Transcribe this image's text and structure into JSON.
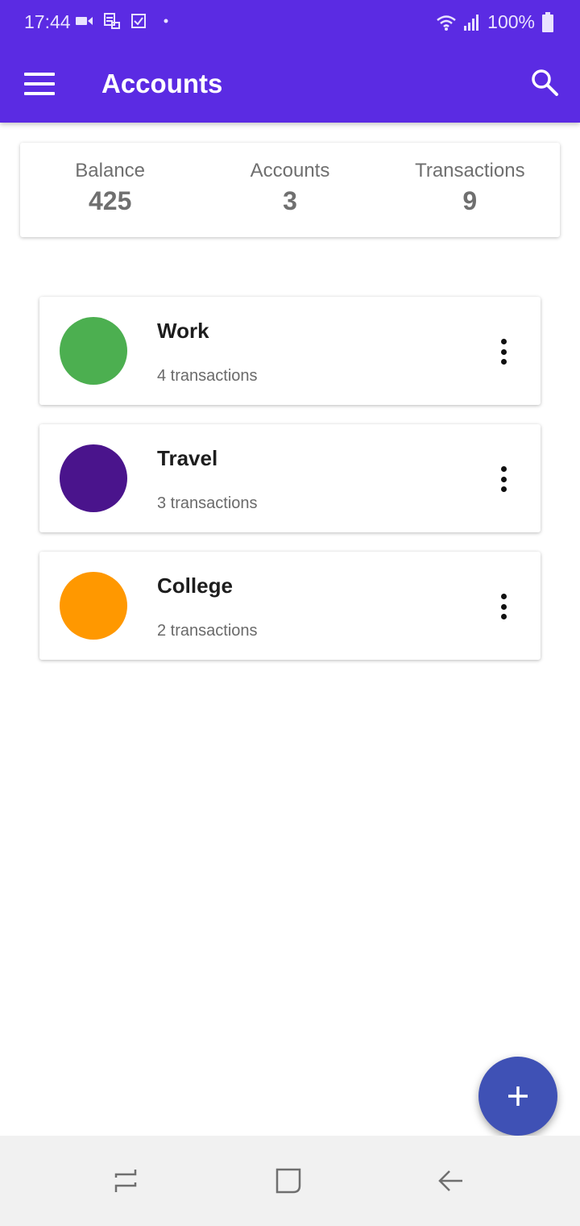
{
  "status_bar": {
    "time": "17:44",
    "battery": "100%",
    "icons": [
      "video-icon",
      "sync-icon",
      "checkbox-icon",
      "dot-icon",
      "wifi-icon",
      "signal-icon",
      "battery-icon"
    ]
  },
  "app_bar": {
    "title": "Accounts",
    "menu_icon": "hamburger-menu-icon",
    "search_icon": "search-icon",
    "color": "#5b2be3"
  },
  "summary": {
    "stats": [
      {
        "label": "Balance",
        "value": "425"
      },
      {
        "label": "Accounts",
        "value": "3"
      },
      {
        "label": "Transactions",
        "value": "9"
      }
    ]
  },
  "accounts": [
    {
      "name": "Work",
      "transactions": "4 transactions",
      "color": "#4caf50"
    },
    {
      "name": "Travel",
      "transactions": "3 transactions",
      "color": "#4a148c"
    },
    {
      "name": "College",
      "transactions": "2 transactions",
      "color": "#ff9800"
    }
  ],
  "fab": {
    "icon": "plus-icon",
    "color": "#3f51b5"
  },
  "nav_bar": {
    "buttons": [
      "recent-apps-icon",
      "home-icon",
      "back-icon"
    ]
  }
}
